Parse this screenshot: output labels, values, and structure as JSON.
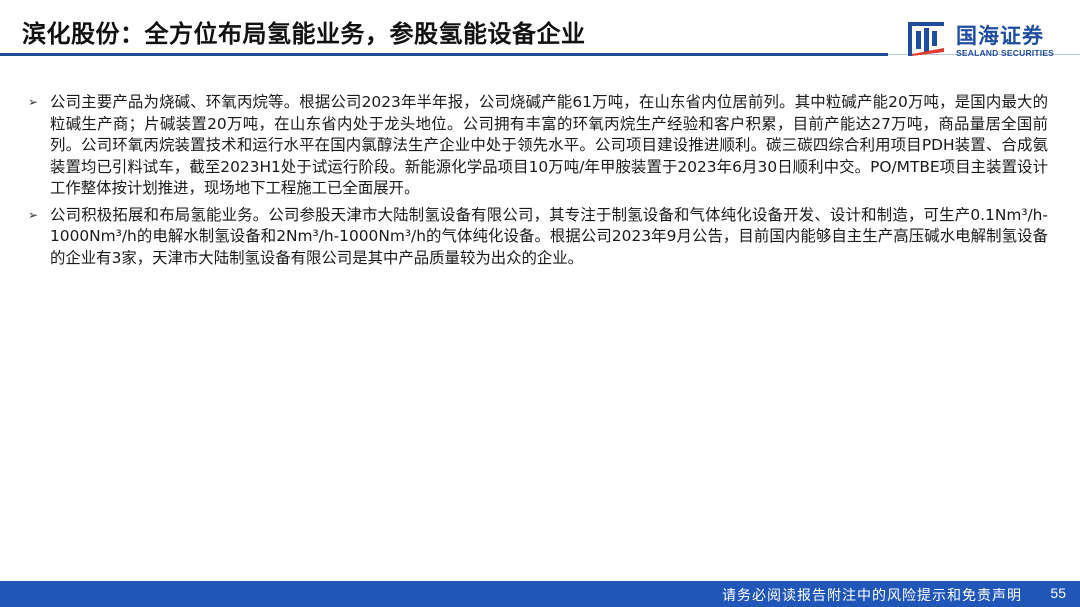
{
  "header": {
    "title": "滨化股份：全方位布局氢能业务，参股氢能设备企业",
    "logo_cn": "国海证券",
    "logo_en": "SEALAND SECURITIES",
    "brand_color": "#1f4e9e"
  },
  "content": {
    "bullets": [
      "公司主要产品为烧碱、环氧丙烷等。根据公司2023年半年报，公司烧碱产能61万吨，在山东省内位居前列。其中粒碱产能20万吨，是国内最大的粒碱生产商；片碱装置20万吨，在山东省内处于龙头地位。公司拥有丰富的环氧丙烷生产经验和客户积累，目前产能达27万吨，商品量居全国前列。公司环氧丙烷装置技术和运行水平在国内氯醇法生产企业中处于领先水平。公司项目建设推进顺利。碳三碳四综合利用项目PDH装置、合成氨装置均已引料试车，截至2023H1处于试运行阶段。新能源化学品项目10万吨/年甲胺装置于2023年6月30日顺利中交。PO/MTBE项目主装置设计工作整体按计划推进，现场地下工程施工已全面展开。",
      "公司积极拓展和布局氢能业务。公司参股天津市大陆制氢设备有限公司，其专注于制氢设备和气体纯化设备开发、设计和制造，可生产0.1Nm³/h-1000Nm³/h的电解水制氢设备和2Nm³/h-1000Nm³/h的气体纯化设备。根据公司2023年9月公告，目前国内能够自主生产高压碱水电解制氢设备的企业有3家，天津市大陆制氢设备有限公司是其中产品质量较为出众的企业。"
    ],
    "bullet_icon": "arrow-bullet-icon"
  },
  "footer": {
    "disclaimer": "请务必阅读报告附注中的风险提示和免责声明",
    "page_number": "55",
    "bar_color": "#1f56b8"
  }
}
